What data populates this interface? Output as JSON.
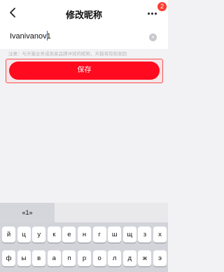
{
  "header": {
    "title": "修改昵称",
    "back_icon": "chevron-left-icon",
    "more_icon": "more-dots-icon",
    "badge_count": "2"
  },
  "nickname": {
    "value": "Ivanivanov1",
    "clear_icon": "clear-circle-icon"
  },
  "notice": "注意：与天猫业务或卖家品牌冲突的昵称，天猫将有权收回",
  "save_button": "保存",
  "keyboard": {
    "suggestion": "«1»",
    "row1": [
      "й",
      "ц",
      "у",
      "к",
      "е",
      "н",
      "г",
      "ш",
      "щ",
      "з",
      "х"
    ],
    "row2": [
      "ф",
      "ы",
      "в",
      "а",
      "п",
      "р",
      "о",
      "л",
      "д",
      "ж",
      "э"
    ]
  }
}
